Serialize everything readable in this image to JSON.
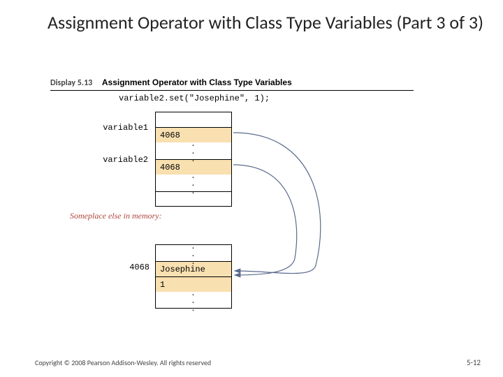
{
  "title": "Assignment Operator with Class Type Variables (Part 3 of 3)",
  "display": {
    "num": "Display 5.13",
    "title": "Assignment Operator with Class Type Variables"
  },
  "code": "variable2.set(\"Josephine\", 1);",
  "labels": {
    "var1": "variable1",
    "var2": "variable2",
    "addr": "4068",
    "val1": "4068",
    "val2": "4068",
    "name": "Josephine",
    "num": "1"
  },
  "someplace": "Someplace else in memory:",
  "footer": {
    "copyright": "Copyright © 2008 Pearson Addison-Wesley. All rights reserved",
    "page": "5-12"
  }
}
